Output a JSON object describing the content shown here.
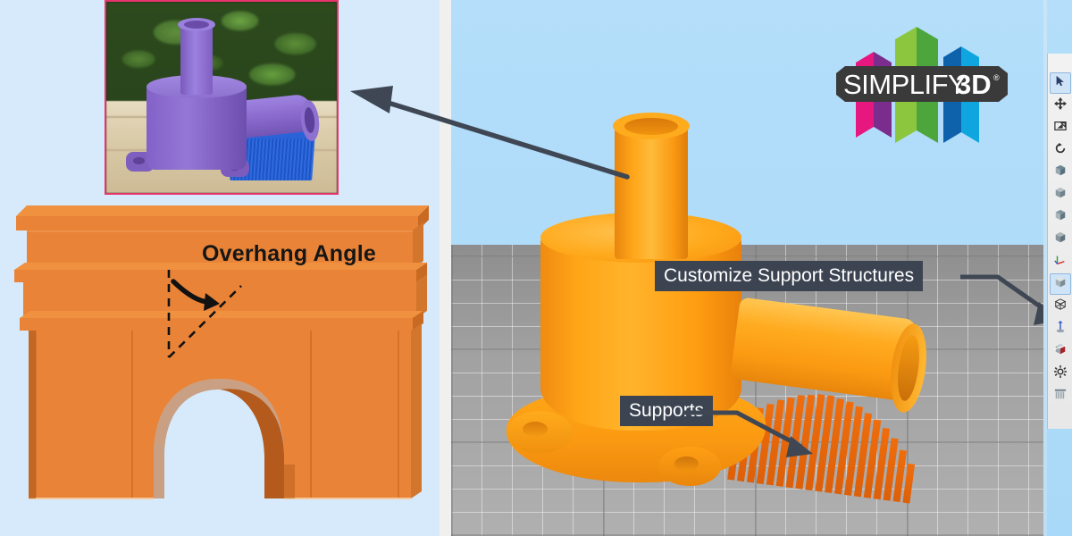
{
  "app": {
    "name": "Simplify3D",
    "logo_text_main": "SIMPLIFY",
    "logo_text_accent": "3D",
    "logo_registered": "®",
    "brand_colors": {
      "magenta": "#e6177e",
      "purple": "#7b2d8e",
      "green_light": "#8cc63f",
      "green_dark": "#4ca63c",
      "blue_dark": "#0d62ab",
      "blue_light": "#0fa6e0",
      "logo_plate": "#3a3a3a"
    }
  },
  "left_panel": {
    "background_color": "#d6eafb",
    "annotation_label": "Overhang Angle",
    "photo_inset": {
      "name": "printed-part-photo",
      "border_color": "#e8336d",
      "description_colors": {
        "part_purple": "#8d71cf",
        "support_blue": "#2a63d8",
        "foliage_green": "#4a7530",
        "table_wood": "#ddcfae"
      }
    },
    "arch_model": {
      "name": "overhang-arch-model",
      "fill": "#e98337",
      "shade_dark": "#c96a23",
      "shade_top": "#f0913f"
    }
  },
  "viewport": {
    "name": "3d-build-viewport",
    "sky_color": "#add9f8",
    "bed_color": "#9a9a9a",
    "model_color": "#ffa719",
    "support_color": "#ef6d0c",
    "callouts": [
      {
        "id": "customize-support-structures",
        "label": "Customize Support Structures"
      },
      {
        "id": "supports",
        "label": "Supports"
      }
    ],
    "arrow_color": "#3f4754"
  },
  "toolbar": {
    "name": "right-tool-strip",
    "items": [
      {
        "id": "select-tool",
        "label": "Select",
        "icon": "cursor-arrow-icon",
        "selected": true
      },
      {
        "id": "pan-tool",
        "label": "Pan",
        "icon": "move-arrows-icon",
        "selected": false
      },
      {
        "id": "screenshot-tool",
        "label": "Screenshot",
        "icon": "screen-capture-icon",
        "selected": false
      },
      {
        "id": "rotate-tool",
        "label": "Rotate View",
        "icon": "rotate-arrow-icon",
        "selected": false
      },
      {
        "id": "view-front",
        "label": "Front View",
        "icon": "cube-front-icon",
        "selected": false
      },
      {
        "id": "view-side",
        "label": "Side View",
        "icon": "cube-side-icon",
        "selected": false
      },
      {
        "id": "view-top",
        "label": "Top View",
        "icon": "cube-top-icon",
        "selected": false
      },
      {
        "id": "view-iso",
        "label": "Isometric View",
        "icon": "cube-iso-icon",
        "selected": false
      },
      {
        "id": "show-axes",
        "label": "Show Axes",
        "icon": "axes-icon",
        "selected": false
      },
      {
        "id": "solid-model-view",
        "label": "Solid Model",
        "icon": "cube-solid-icon",
        "selected": true
      },
      {
        "id": "wireframe-view",
        "label": "Wireframe",
        "icon": "cube-wireframe-icon",
        "selected": false
      },
      {
        "id": "origin-marker",
        "label": "Origin Marker",
        "icon": "pin-axis-icon",
        "selected": false
      },
      {
        "id": "cross-section",
        "label": "Cross Section",
        "icon": "cross-section-icon",
        "selected": false
      },
      {
        "id": "settings",
        "label": "Settings",
        "icon": "gear-icon",
        "selected": false
      },
      {
        "id": "remove-supports",
        "label": "Remove Supports",
        "icon": "supports-icon",
        "selected": false
      }
    ]
  }
}
